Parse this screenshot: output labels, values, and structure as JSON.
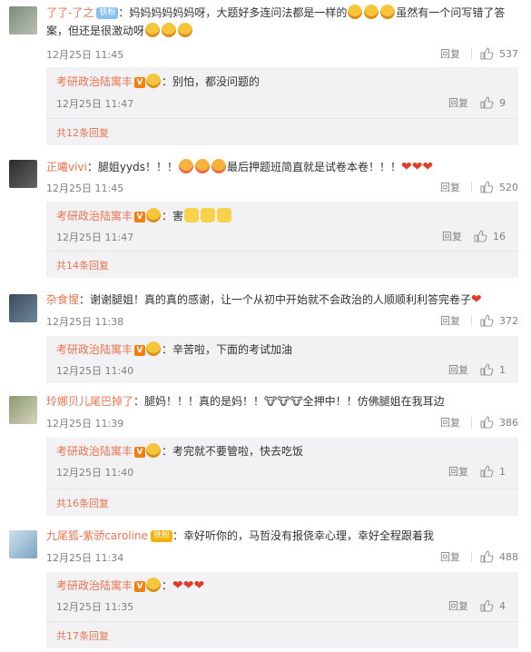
{
  "comments": [
    {
      "user": "了了-了之",
      "badge": "铁粉",
      "text_a": "妈妈妈妈妈妈呀，大题好多连问法都是一样的",
      "text_b": "虽然有一个问写错了答案，但还是很激动呀",
      "time": "12月25日 11:45",
      "reply_label": "回复",
      "likes": "537",
      "sub": {
        "author": "考研政治陆寓丰",
        "text": "：别怕，都没问题的",
        "time": "12月25日 11:47",
        "reply_label": "回复",
        "likes": "9",
        "more": "共12条回复"
      }
    },
    {
      "user": "正曦vivi",
      "text_a": "：腿姐yyds！！！",
      "text_b": "最后押题班简直就是试卷本卷！！！",
      "time": "12月25日 11:45",
      "reply_label": "回复",
      "likes": "520",
      "sub": {
        "author": "考研政治陆寓丰",
        "text": "：害",
        "time": "12月25日 11:47",
        "reply_label": "回复",
        "likes": "16",
        "more": "共14条回复"
      }
    },
    {
      "user": "杂食惺",
      "text_a": "：谢谢腿姐！真的真的感谢，让一个从初中开始就不会政治的人顺顺利利答完卷子",
      "time": "12月25日 11:38",
      "reply_label": "回复",
      "likes": "372",
      "sub": {
        "author": "考研政治陆寓丰",
        "text": "：辛苦啦，下面的考试加油",
        "time": "12月25日 11:40",
        "reply_label": "回复",
        "likes": "1"
      }
    },
    {
      "user": "玲娜贝儿尾巴掉了",
      "text_a": "：腿妈！！！真的是妈！！",
      "text_b": "全押中！！仿佛腿姐在我耳边",
      "time": "12月25日 11:39",
      "reply_label": "回复",
      "likes": "386",
      "sub": {
        "author": "考研政治陆寓丰",
        "text": "：考完就不要管啦，快去吃饭",
        "time": "12月25日 11:40",
        "reply_label": "回复",
        "likes": "1",
        "more": "共16条回复"
      }
    },
    {
      "user": "九尾狐-紫骄caroline",
      "badge": "铁粉",
      "text_a": "：幸好听你的，马哲没有报侥幸心理，幸好全程跟着我",
      "time": "12月25日 11:34",
      "reply_label": "回复",
      "likes": "488",
      "sub": {
        "author": "考研政治陆寓丰",
        "text": "：",
        "time": "12月25日 11:35",
        "reply_label": "回复",
        "likes": "4",
        "more": "共17条回复"
      }
    }
  ],
  "vip_mark": "V",
  "icons": {
    "like": "thumb-up-icon",
    "avatar": "avatar",
    "emoji": "emoji-icon"
  },
  "colors": {
    "username": "#eb7350",
    "meta": "#808080",
    "subbg": "#f2f2f5"
  }
}
